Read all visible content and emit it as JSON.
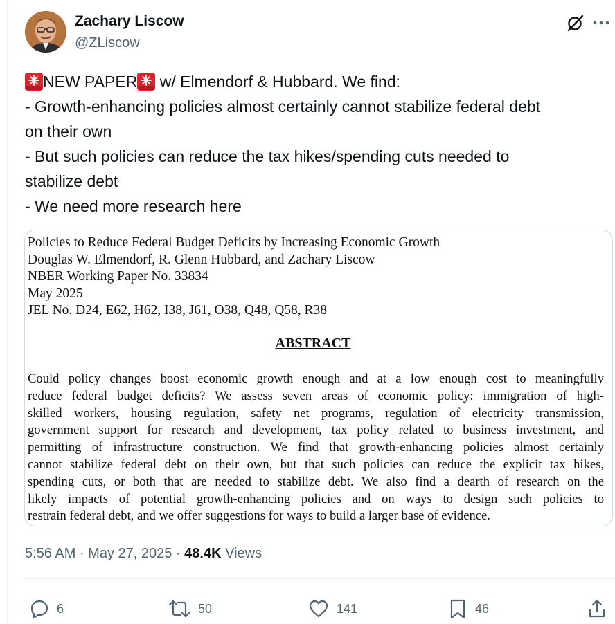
{
  "author": {
    "name": "Zachary Liscow",
    "handle": "@ZLiscow"
  },
  "tweet": {
    "line1_a": "NEW PAPER",
    "line1_b": " w/ Elmendorf & Hubbard. We find:",
    "line2": "- Growth-enhancing policies almost certainly cannot stabilize federal debt",
    "line3": "on their own",
    "line4": "- But such policies can reduce the tax hikes/spending cuts needed to",
    "line5": "stabilize debt",
    "line6": "- We need more research here",
    "emoji": "rotating-light-siren"
  },
  "paper": {
    "title": "Policies to Reduce Federal Budget Deficits by Increasing Economic Growth",
    "authors": "Douglas W. Elmendorf, R. Glenn Hubbard, and Zachary Liscow",
    "series": "NBER Working Paper No. 33834",
    "date": "May 2025",
    "jel": "JEL No. D24, E62, H62, I38, J61, O38, Q48, Q58, R38",
    "abstract_heading": "ABSTRACT",
    "abstract_lines": [
      "Could policy changes boost economic growth enough and at a low enough cost to meaningfully",
      "reduce federal budget deficits? We assess seven areas of economic policy: immigration of high-",
      "skilled workers, housing regulation, safety net programs, regulation of electricity transmission,",
      "government support for research and development, tax policy related to business investment, and",
      "permitting of infrastructure construction. We find that growth-enhancing policies almost certainly",
      "cannot stabilize federal debt on their own, but that such policies can reduce the explicit tax hikes,",
      "spending cuts, or both that are needed to stabilize debt. We also find a dearth of research on the",
      "likely impacts of potential growth-enhancing policies and on ways to design such policies to",
      "restrain federal debt, and we offer suggestions for ways to build a larger base of evidence."
    ]
  },
  "meta": {
    "time": "5:56 AM",
    "separator1": " · ",
    "date": "May 27, 2025",
    "separator2": " · ",
    "views_count": "48.4K",
    "views_label": " Views"
  },
  "actions": {
    "replies": "6",
    "reposts": "50",
    "likes": "141",
    "bookmarks": "46"
  },
  "icons": [
    "grok-icon",
    "more-icon",
    "reply-icon",
    "repost-icon",
    "like-icon",
    "bookmark-icon",
    "share-icon",
    "siren-icon"
  ],
  "colors": {
    "text": "#0f1419",
    "secondary": "#536471",
    "border": "#cfd9de",
    "siren_red": "#e0242f"
  }
}
